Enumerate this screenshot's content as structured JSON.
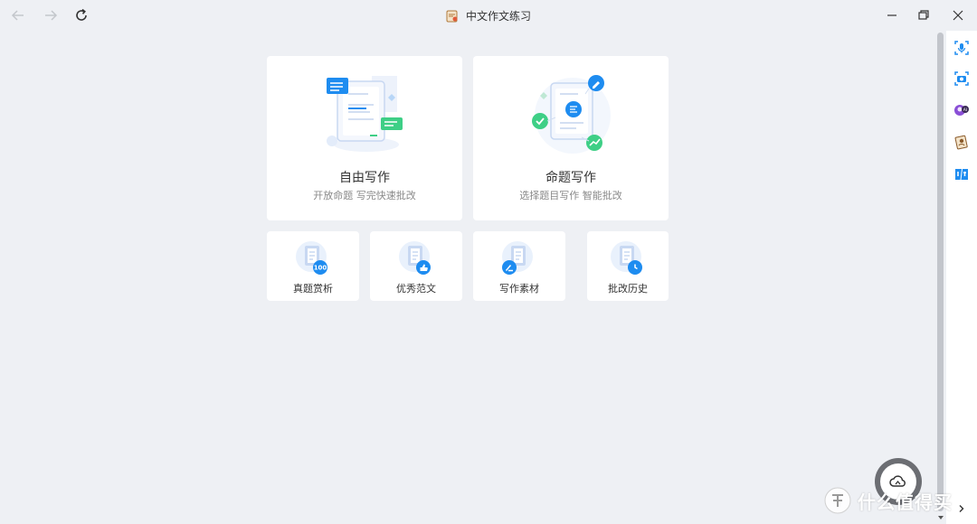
{
  "window": {
    "title": "中文作文练习"
  },
  "toolbar": {
    "back_icon": "arrow-left-icon",
    "forward_icon": "arrow-right-icon",
    "refresh_icon": "refresh-icon"
  },
  "window_controls": [
    "minimize-icon",
    "restore-icon",
    "close-icon"
  ],
  "main_cards": [
    {
      "title": "自由写作",
      "subtitle": "开放命题 写完快速批改",
      "icon": "free-writing-illustration"
    },
    {
      "title": "命题写作",
      "subtitle": "选择题目写作 智能批改",
      "icon": "topic-writing-illustration"
    }
  ],
  "tool_cards": [
    {
      "label": "真题赏析",
      "icon": "exam-appreciation-icon",
      "badge": "100"
    },
    {
      "label": "优秀范文",
      "icon": "excellent-essay-icon"
    },
    {
      "label": "写作素材",
      "icon": "writing-material-icon"
    },
    {
      "label": "批改历史",
      "icon": "correction-history-icon"
    }
  ],
  "sidebar": {
    "items": [
      "voice-icon",
      "camera-icon",
      "avatar-icon",
      "profile-card-icon",
      "translate-icon"
    ]
  },
  "floating": {
    "icon": "cloud-icon"
  },
  "watermark": {
    "text": "什么值得买"
  },
  "colors": {
    "background": "#eef0f4",
    "card": "#ffffff",
    "accent_blue": "#1e8cf0",
    "accent_green": "#3ecf86"
  }
}
